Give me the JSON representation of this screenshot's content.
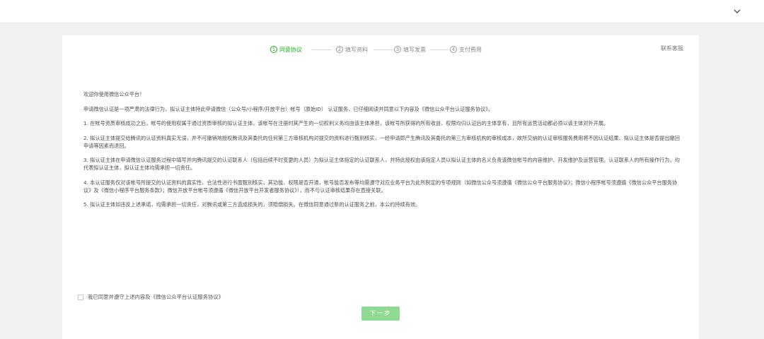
{
  "steps": [
    {
      "num": "1",
      "label": "同意协议",
      "active": true
    },
    {
      "num": "2",
      "label": "填写资料",
      "active": false
    },
    {
      "num": "3",
      "label": "填写发票",
      "active": false
    },
    {
      "num": "4",
      "label": "支付费用",
      "active": false
    }
  ],
  "header": {
    "contact_label": "联系客服"
  },
  "agreement": {
    "greeting": "欢迎你使用微信公众平台！",
    "intro": "申请微信认证是一项严肃的法律行为，拟认证主体特此申请微信（公众号/小程序/开放平台）帐号（原始ID） 认证服务，已仔细阅读并同意以下内容及《微信公众平台认证服务协议》。",
    "clauses": [
      "1. 在帐号资质审核成功之后，帐号的使用权属于通过资质审核的拟认证主体，该帐号在注册时其产生的一切权利义务均由该主体承担，该帐号所获得的所有收益、权限均归认证后的主体享有，且所有运营活动都必须以该主体对外开展。",
      "2. 拟认证主体提交给腾讯的认证资料真实无误，并不可撤销地授权腾讯及其委托的任何第三方审核机构对提交的资料进行甄别核实，一经申请即产生腾讯及其委托的第三方审核机构的审核成本，故所交纳的认证审核服务费用将不因认证结果、拟认证主体是否提出撤回申请等因素而退回。",
      "3. 拟认证主体在申请微信认证服务过程中填写并向腾讯提交的认证联系人（包括后续不时变更的人员）为拟认证主体指定的认证联系人，并特此授权由该指定人员以拟认证主体的名义负责该微信帐号的内容维护、开发维护及运营管理。认证联系人的所有操作行为，均代表拟认证主体，拟认证主体均需承担一切责任。",
      "4. 本认证服务仅对该帐号所提交的认证资料的真实性、合法性进行书面甄别核实，其功能、权限是否开通，帐号能否发布等均需遵守对应业务平台为此所制定的专项规则（如微信公众号须遵循《微信公众平台服务协议》；微信小程序帐号须遵循《微信公众平台服务协议》及《微信小程序平台服务条款》；微信开放平台帐号须遵循《微信开放平台开发者服务协议》），而不与认证审核结果存在直接关联。",
      "5. 拟认证主体如违反上述承诺，均需承担一切责任，对腾讯或第三方造成损失的，须赔偿损失。在微信同意通过新的认证服务之前，本公约持续有效。"
    ]
  },
  "consent": {
    "label": "我已同意并遵守上述内容及《微信公众平台认证服务协议》",
    "checked": false
  },
  "actions": {
    "next_label": "下一步"
  },
  "colors": {
    "accent": "#1aad19",
    "button_disabled": "#8fd992",
    "page_bg": "#f2f2f2"
  },
  "icons": {
    "top_right": "chevron-down-icon"
  }
}
